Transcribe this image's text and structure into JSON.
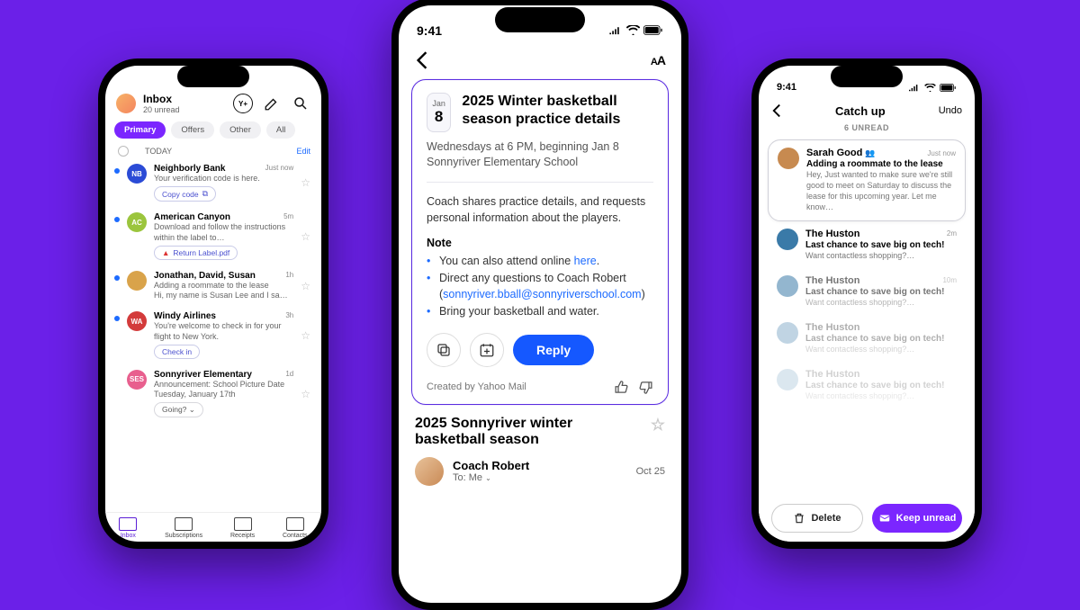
{
  "status_time": "9:41",
  "left": {
    "title": "Inbox",
    "subtitle": "20 unread",
    "tabs": [
      "Primary",
      "Offers",
      "Other",
      "All"
    ],
    "today_label": "TODAY",
    "edit": "Edit",
    "messages": [
      {
        "unread": true,
        "av_bg": "#2b4bd6",
        "av_txt": "NB",
        "from": "Neighborly Bank",
        "time": "Just now",
        "preview": "Your verification code is here.",
        "chip": "Copy code",
        "chip_icon": "copy"
      },
      {
        "unread": true,
        "av_bg": "#9bc53d",
        "av_txt": "AC",
        "from": "American Canyon",
        "time": "5m",
        "preview": "Download and follow the instructions within the label to…",
        "chip": "Return Label.pdf",
        "chip_icon": "pdf",
        "two": true
      },
      {
        "unread": true,
        "av_bg": "#d9a34a",
        "av_txt": "",
        "from": "Jonathan, David, Susan",
        "time": "1h",
        "preview2": "Adding a roommate to the lease",
        "preview": "Hi, my name is Susan Lee and I sa…"
      },
      {
        "unread": true,
        "av_bg": "#d33b3b",
        "av_txt": "WA",
        "from": "Windy Airlines",
        "time": "3h",
        "preview": "You're welcome to check in for your flight to New York.",
        "chip": "Check in",
        "two": true
      },
      {
        "unread": false,
        "av_bg": "#e85f8e",
        "av_txt": "SES",
        "from": "Sonnyriver Elementary",
        "time": "1d",
        "preview": "Announcement: School Picture Date Tuesday, January 17th",
        "chip": "Going?",
        "chip_dd": true,
        "chip_gray": true,
        "two": true
      }
    ],
    "bottombar": [
      "Inbox",
      "Subscriptions",
      "Receipts",
      "Contacts"
    ]
  },
  "mid": {
    "date_month": "Jan",
    "date_day": "8",
    "title": "2025 Winter basketball season practice details",
    "sub": "Wednesdays at 6 PM, beginning Jan 8\nSonnyriver Elementary School",
    "summary": "Coach shares practice details, and requests personal information about the players.",
    "note_label": "Note",
    "bullets": [
      {
        "pre": "You can also attend online ",
        "link": "here",
        "post": "."
      },
      {
        "pre": "Direct any questions to Coach Robert (",
        "link": "sonnyriver.bball@sonnyriverschool.com",
        "post": ")"
      },
      {
        "pre": "Bring your basketball and water.",
        "link": "",
        "post": ""
      }
    ],
    "reply": "Reply",
    "created": "Created by Yahoo Mail",
    "thread_title": "2025 Sonnyriver winter basketball season",
    "sender_name": "Coach Robert",
    "sender_to": "To: Me",
    "sender_date": "Oct 25"
  },
  "right": {
    "title": "Catch up",
    "undo": "Undo",
    "unread": "6 UNREAD",
    "items": [
      {
        "from": "Sarah Good",
        "badge": true,
        "time": "Just now",
        "subj": "Adding a roommate to the lease",
        "prev": "Hey, Just wanted to make sure we're still good to meet on Saturday to discuss the lease for this upcoming year. Let me know…",
        "av": "#c78a50",
        "card": true
      },
      {
        "from": "The Huston",
        "time": "2m",
        "subj": "Last chance to save big on tech!",
        "prev": "Want contactless shopping?…",
        "av": "#3a7aa8"
      },
      {
        "from": "The Huston",
        "time": "10m",
        "subj": "Last chance to save big on tech!",
        "prev": "Want contactless shopping?…",
        "av": "#3a7aa8",
        "fade": 1
      },
      {
        "from": "The Huston",
        "time": "",
        "subj": "Last chance to save big on tech!",
        "prev": "Want contactless shopping?…",
        "av": "#3a7aa8",
        "fade": 2
      },
      {
        "from": "The Huston",
        "time": "",
        "subj": "Last chance to save big on tech!",
        "prev": "Want contactless shopping?…",
        "av": "#3a7aa8",
        "fade": 3
      }
    ],
    "delete": "Delete",
    "keep": "Keep unread"
  }
}
